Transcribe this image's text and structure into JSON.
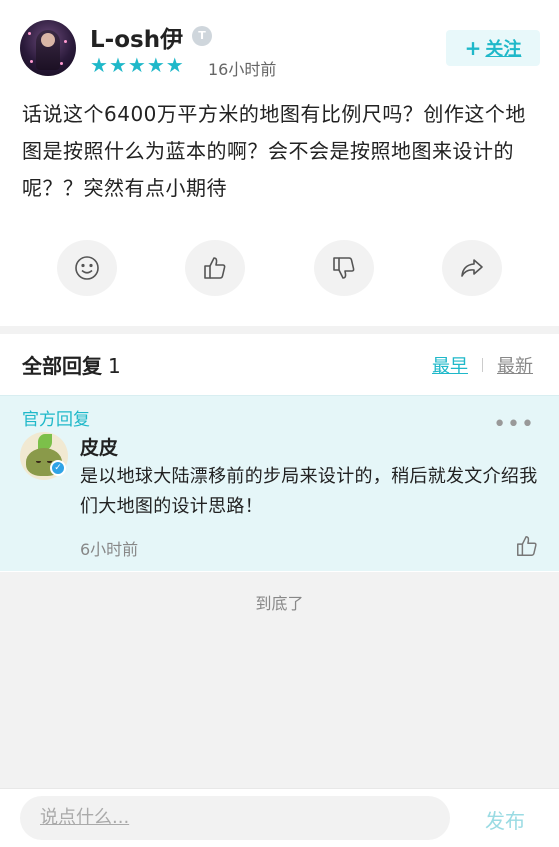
{
  "post": {
    "author_name": "L-osh伊",
    "level_badge": "T",
    "rating_stars": 5,
    "time": "16小时前",
    "follow_label": "关注",
    "follow_plus": "+",
    "text": "话说这个6400万平方米的地图有比例尺吗？创作这个地图是按照什么为蓝本的啊？会不会是按照地图来设计的呢？？突然有点小期待"
  },
  "actions": [
    {
      "icon": "smile-icon"
    },
    {
      "icon": "thumbs-up-icon"
    },
    {
      "icon": "thumbs-down-icon"
    },
    {
      "icon": "share-icon"
    }
  ],
  "replies": {
    "title": "全部回复",
    "count": "1",
    "sort_earliest": "最早",
    "sort_latest": "最新",
    "items": [
      {
        "tag": "官方回复",
        "name": "皮皮",
        "text": "是以地球大陆漂移前的步局来设计的，稍后就发文介绍我们大地图的设计思路！",
        "time": "6小时前",
        "more": "•••"
      }
    ]
  },
  "end_text": "到底了",
  "composer": {
    "placeholder": "说点什么...",
    "publish_label": "发布"
  },
  "colors": {
    "accent": "#1fb8c9",
    "reply_bg": "#e5f6f8",
    "page_gray": "#f2f2f2"
  }
}
